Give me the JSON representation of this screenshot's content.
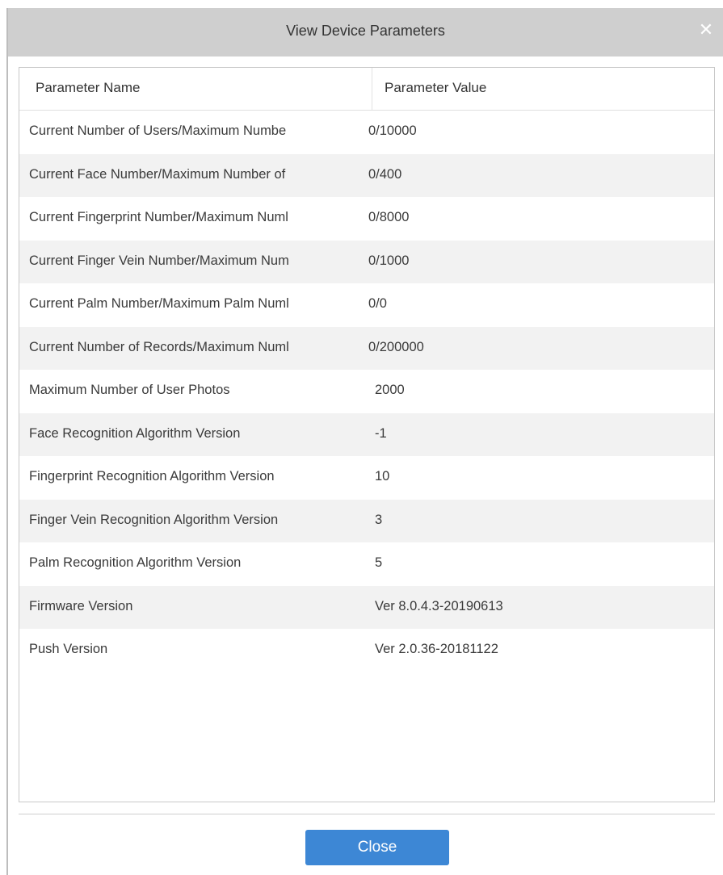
{
  "dialog": {
    "title": "View Device Parameters",
    "close_icon": "close-icon",
    "close_button_label": "Close"
  },
  "table": {
    "columns": [
      "Parameter Name",
      "Parameter Value"
    ],
    "rows": [
      {
        "name": "Current Number of Users/Maximum Numbe",
        "value": "0/10000"
      },
      {
        "name": "Current Face Number/Maximum Number of",
        "value": "0/400"
      },
      {
        "name": "Current Fingerprint Number/Maximum Numl",
        "value": "0/8000"
      },
      {
        "name": "Current Finger Vein Number/Maximum Num",
        "value": "0/1000"
      },
      {
        "name": "Current Palm Number/Maximum Palm Numl",
        "value": "0/0"
      },
      {
        "name": "Current Number of Records/Maximum Numl",
        "value": "0/200000"
      },
      {
        "name": "Maximum Number of User Photos",
        "value": "2000"
      },
      {
        "name": "Face Recognition Algorithm Version",
        "value": "-1"
      },
      {
        "name": "Fingerprint Recognition Algorithm Version",
        "value": "10"
      },
      {
        "name": "Finger Vein Recognition Algorithm Version",
        "value": "3"
      },
      {
        "name": "Palm Recognition Algorithm Version",
        "value": "5"
      },
      {
        "name": "Firmware Version",
        "value": "Ver 8.0.4.3-20190613"
      },
      {
        "name": "Push Version",
        "value": "Ver 2.0.36-20181122"
      }
    ]
  },
  "colors": {
    "titlebar_bg": "#cfcfcf",
    "row_alt_bg": "#f2f2f2",
    "button_bg": "#3d87d5"
  }
}
